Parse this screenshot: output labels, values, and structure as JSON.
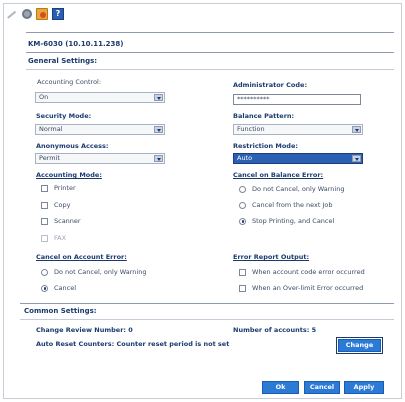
{
  "toolbar": {
    "icons": [
      "pencil-icon",
      "gear-icon",
      "folder-icon",
      "help-icon"
    ],
    "help_glyph": "?"
  },
  "device": {
    "title": "KM-6030 (10.10.11.238)"
  },
  "general": {
    "title": "General Settings:",
    "accounting_control": {
      "label": "Accounting Control:",
      "value": "On"
    },
    "administrator_code": {
      "label": "Administrator Code:",
      "value": "**********"
    },
    "security_mode": {
      "label": "Security Mode:",
      "value": "Normal"
    },
    "balance_pattern": {
      "label": "Balance Pattern:",
      "value": "Function"
    },
    "anonymous_access": {
      "label": "Anonymous Access:",
      "value": "Permit"
    },
    "restriction_mode": {
      "label": "Restriction Mode:",
      "value": "Auto"
    },
    "accounting_mode": {
      "label": "Accounting Mode:",
      "options": [
        {
          "label": "Printer",
          "checked": false,
          "enabled": true
        },
        {
          "label": "Copy",
          "checked": false,
          "enabled": true
        },
        {
          "label": "Scanner",
          "checked": false,
          "enabled": true
        },
        {
          "label": "FAX",
          "checked": false,
          "enabled": false
        }
      ]
    },
    "cancel_on_balance_error": {
      "label": "Cancel on Balance Error:",
      "options": [
        {
          "label": "Do not Cancel, only Warning",
          "selected": false
        },
        {
          "label": "Cancel from the next Job",
          "selected": false
        },
        {
          "label": "Stop Printing, and Cancel",
          "selected": true
        }
      ]
    },
    "cancel_on_account_error": {
      "label": "Cancel on Account Error:",
      "options": [
        {
          "label": "Do not Cancel, only Warning",
          "selected": false
        },
        {
          "label": "Cancel",
          "selected": true
        }
      ]
    },
    "error_report_output": {
      "label": "Error Report Output:",
      "options": [
        {
          "label": "When account code error occurred",
          "checked": false
        },
        {
          "label": "When an Over-limit Error occurred",
          "checked": false
        }
      ]
    }
  },
  "common": {
    "title": "Common Settings:",
    "change_review": "Change Review Number: 0",
    "number_of_accounts": "Number of accounts: 5",
    "auto_reset": "Auto Reset Counters: Counter reset period is not set",
    "change_button": "Change"
  },
  "footer": {
    "ok": "Ok",
    "cancel": "Cancel",
    "apply": "Apply"
  },
  "colors": {
    "accent": "#2b7ad6",
    "text": "#1a3a6e",
    "selected": "#2b5fb4"
  }
}
